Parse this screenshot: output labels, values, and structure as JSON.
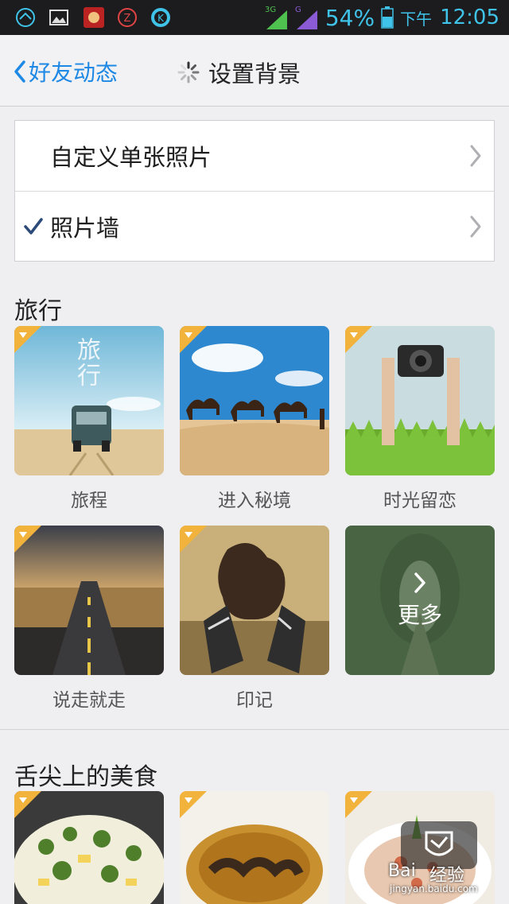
{
  "status_bar": {
    "net3g": "3G",
    "netg": "G",
    "battery": "54%",
    "ampm": "下午",
    "time": "12:05"
  },
  "header": {
    "back_label": "好友动态",
    "title": "设置背景"
  },
  "options": [
    {
      "label": "自定义单张照片",
      "checked": false
    },
    {
      "label": "照片墙",
      "checked": true
    }
  ],
  "sections": [
    {
      "title": "旅行",
      "items": [
        {
          "label": "旅程",
          "tile_text": "旅行"
        },
        {
          "label": "进入秘境"
        },
        {
          "label": "时光留恋"
        },
        {
          "label": "说走就走"
        },
        {
          "label": "印记"
        },
        {
          "label": "更多"
        }
      ]
    },
    {
      "title": "舌尖上的美食",
      "items": [
        {
          "label": ""
        },
        {
          "label": ""
        },
        {
          "label": ""
        }
      ]
    }
  ],
  "watermark": {
    "brand": "Bai",
    "brand2": "经验",
    "url": "jingyan.baidu.com"
  },
  "colors": {
    "accent": "#1e88e5",
    "status_text": "#3fc3e9",
    "badge": "#f2b33d"
  }
}
